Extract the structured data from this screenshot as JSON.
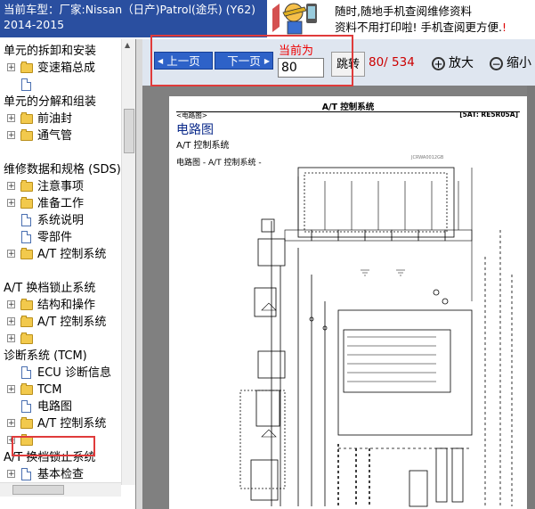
{
  "header": {
    "car_line": "当前车型：厂家:Nissan（日产)Patrol(途乐) (Y62)",
    "years": "2014-2015"
  },
  "banner": {
    "line1": "随时,随地手机查阅维修资料",
    "line2": "资料不用打印啦! 手机查阅更方便.",
    "line2_mark": "!"
  },
  "sidebar": {
    "items": [
      {
        "label": "单元的拆卸和安装",
        "type": "heading"
      },
      {
        "label": "变速箱总成",
        "type": "folder"
      },
      {
        "label": "",
        "type": "doc"
      },
      {
        "label": "单元的分解和组装",
        "type": "heading"
      },
      {
        "label": "前油封",
        "type": "folder"
      },
      {
        "label": "通气管",
        "type": "folder"
      },
      {
        "label": "维修数据和规格 (SDS)",
        "type": "heading"
      },
      {
        "label": "注意事项",
        "type": "folder"
      },
      {
        "label": "准备工作",
        "type": "folder"
      },
      {
        "label": "系统说明",
        "type": "doc"
      },
      {
        "label": "零部件",
        "type": "doc"
      },
      {
        "label": "A/T 控制系统",
        "type": "folder"
      },
      {
        "label": "A/T 换档锁止系统",
        "type": "heading"
      },
      {
        "label": "结构和操作",
        "type": "folder"
      },
      {
        "label": "A/T 控制系统",
        "type": "folder"
      },
      {
        "label": "",
        "type": "folder"
      },
      {
        "label": "诊断系统 (TCM)",
        "type": "heading"
      },
      {
        "label": "ECU 诊断信息",
        "type": "doc"
      },
      {
        "label": "TCM",
        "type": "folder"
      },
      {
        "label": "电路图",
        "type": "doc"
      },
      {
        "label": "A/T 控制系统",
        "type": "folder"
      },
      {
        "label": "",
        "type": "folder"
      },
      {
        "label": "A/T 换档锁止系统",
        "type": "heading"
      },
      {
        "label": "基本检查",
        "type": "doc"
      }
    ]
  },
  "toolbar": {
    "prev_label": "上一页",
    "next_label": "下一页",
    "current_label": "当前为",
    "page_value": "80",
    "jump_label": "跳转",
    "page_count": "80/ 534",
    "zoom_in_label": "放大",
    "zoom_out_label": "缩小"
  },
  "document": {
    "header": "A/T 控制系统",
    "section": "<电路图>",
    "code": "[5AT: RE5R05A]",
    "title": "电路图",
    "subtitle": "A/T 控制系统",
    "diagram_caption": "电路图 - A/T 控制系统 -",
    "diagram_ref": "JCRWA0012GB"
  }
}
